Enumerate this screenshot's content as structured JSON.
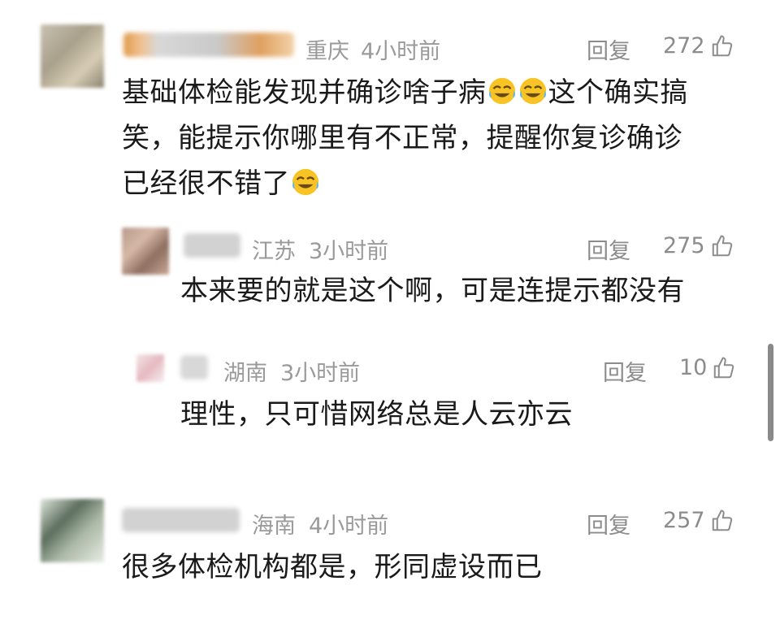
{
  "comments": [
    {
      "location": "重庆",
      "time": "4小时前",
      "reply_label": "回复",
      "likes": "272",
      "lines": [
        "基础体检能发现并确诊啥子病",
        "这个确实搞",
        "笑，能提示你哪里有不正常，提醒你复诊确诊",
        "已经很不错了"
      ],
      "emoji": "face-with-tears-of-joy"
    },
    {
      "location": "江苏",
      "time": "3小时前",
      "reply_label": "回复",
      "likes": "275",
      "lines": [
        "本来要的就是这个啊，可是连提示都没有"
      ]
    },
    {
      "location": "湖南",
      "time": "3小时前",
      "reply_label": "回复",
      "likes": "10",
      "lines": [
        "理性，只可惜网络总是人云亦云"
      ]
    },
    {
      "location": "海南",
      "time": "4小时前",
      "reply_label": "回复",
      "likes": "257",
      "lines": [
        "很多体检机构都是，形同虚设而已"
      ]
    }
  ],
  "icons": {
    "like": "thumbs-up-outline-icon",
    "emoji": "face-with-tears-of-joy"
  },
  "colors": {
    "meta": "#9a9a9a",
    "text": "#1a1a1a",
    "scrollbar": "#8a8a8a"
  }
}
